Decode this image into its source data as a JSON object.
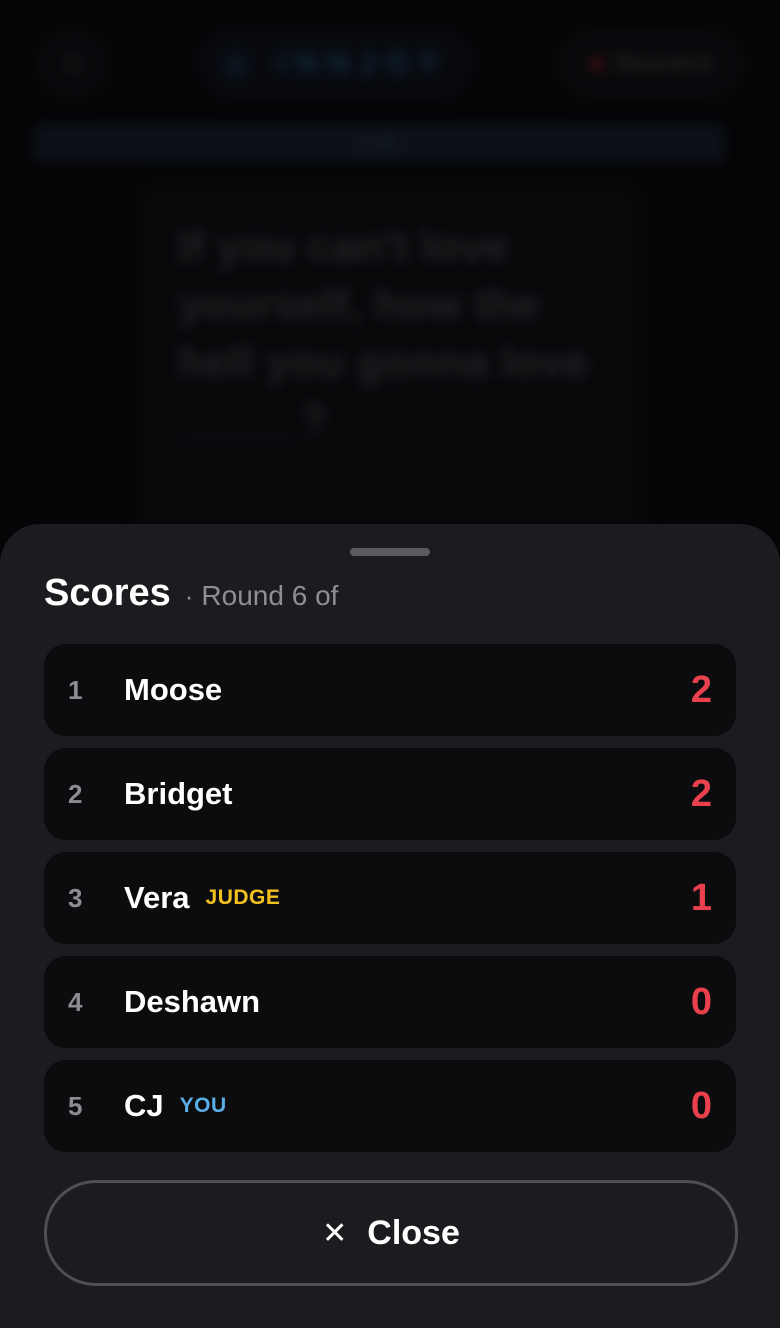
{
  "background": {
    "close_glyph": "✕",
    "logo_text": "◎ INNJOY",
    "round_pill": "Round 6",
    "timer_bar": "0:35",
    "prompt_text": "If you can't love yourself, how the hell you gonna love _____?"
  },
  "sheet": {
    "title": "Scores",
    "separator": "·",
    "subtitle": "Round 6 of",
    "close_label": "Close",
    "close_glyph": "✕"
  },
  "players": [
    {
      "rank": "1",
      "name": "Moose",
      "tag": "",
      "score": "2"
    },
    {
      "rank": "2",
      "name": "Bridget",
      "tag": "",
      "score": "2"
    },
    {
      "rank": "3",
      "name": "Vera",
      "tag": "JUDGE",
      "score": "1"
    },
    {
      "rank": "4",
      "name": "Deshawn",
      "tag": "",
      "score": "0"
    },
    {
      "rank": "5",
      "name": "CJ",
      "tag": "YOU",
      "score": "0"
    }
  ],
  "colors": {
    "score": "#e8404c",
    "judge_tag": "#f4c21f",
    "you_tag": "#5aaee6",
    "sheet_bg": "#1c1c20",
    "row_bg": "#0c0c0f"
  }
}
